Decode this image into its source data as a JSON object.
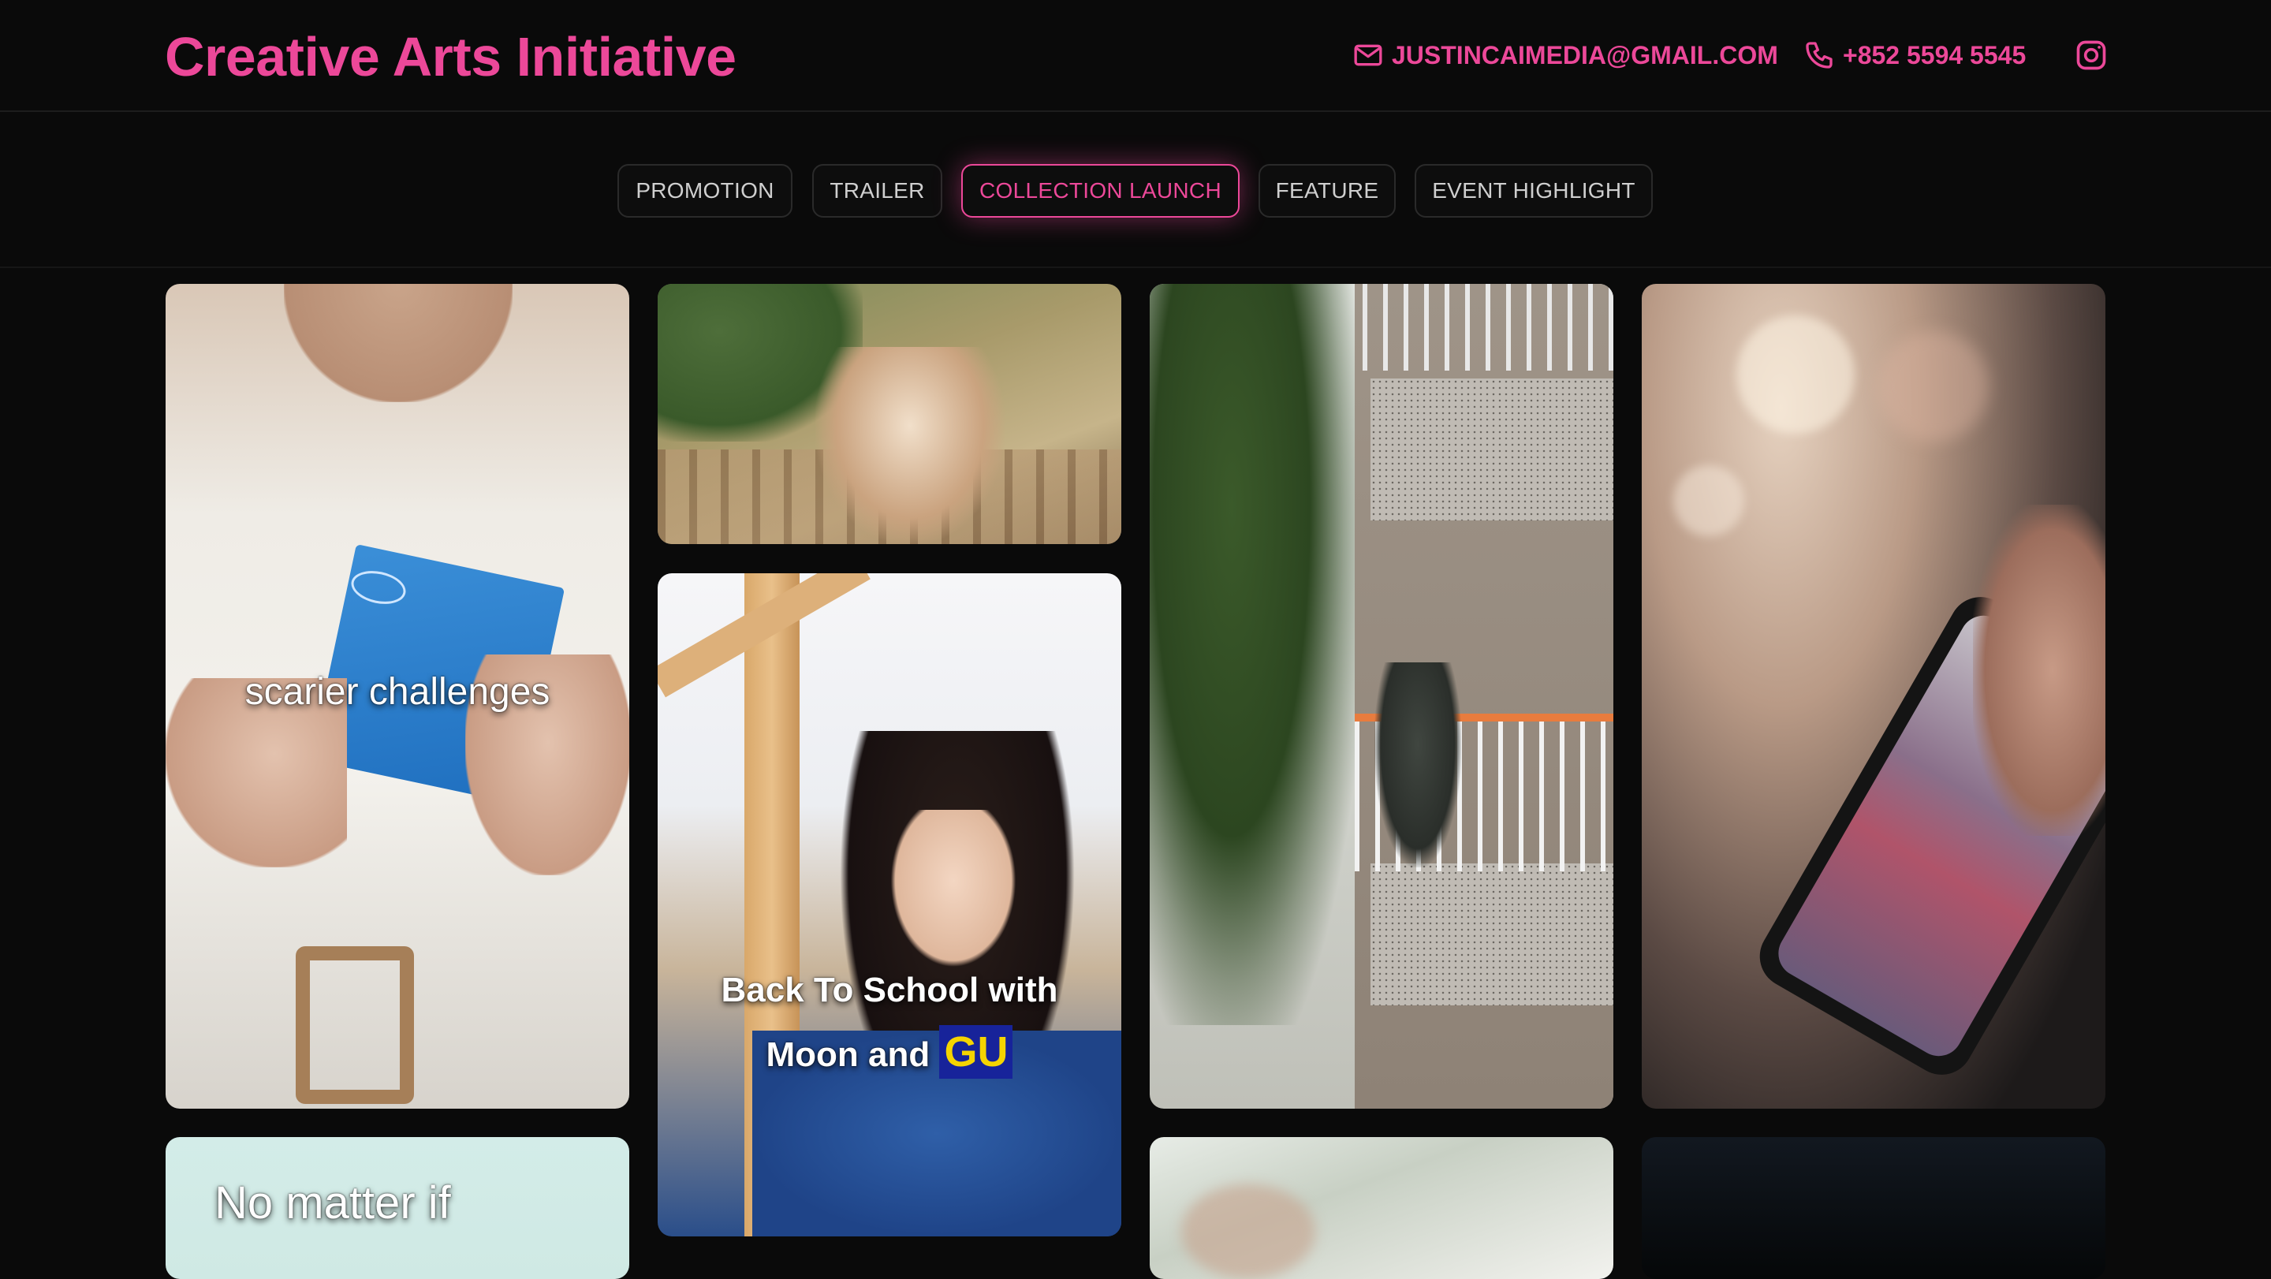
{
  "header": {
    "brand": "Creative Arts Initiative",
    "email": "JUSTINCAIMEDIA@GMAIL.COM",
    "phone": "+852 5594 5545",
    "icons": {
      "email": "mail-icon",
      "phone": "phone-icon",
      "social": "instagram-icon"
    }
  },
  "tabs": [
    {
      "label": "PROMOTION",
      "active": false
    },
    {
      "label": "TRAILER",
      "active": false
    },
    {
      "label": "COLLECTION LAUNCH",
      "active": true
    },
    {
      "label": "FEATURE",
      "active": false
    },
    {
      "label": "EVENT HIGHLIGHT",
      "active": false
    }
  ],
  "cards": [
    {
      "caption": "scarier challenges"
    },
    {
      "caption": ""
    },
    {
      "caption_line1": "Back To School with",
      "caption_line2": "Moon and",
      "caption_badge": "GU"
    },
    {
      "caption": ""
    },
    {
      "caption": ""
    },
    {
      "caption": "No matter if"
    },
    {
      "caption": ""
    },
    {
      "caption": ""
    }
  ],
  "colors": {
    "accent": "#ec4899",
    "background": "#0a0a0a",
    "tab_text": "#cfcfcf"
  }
}
